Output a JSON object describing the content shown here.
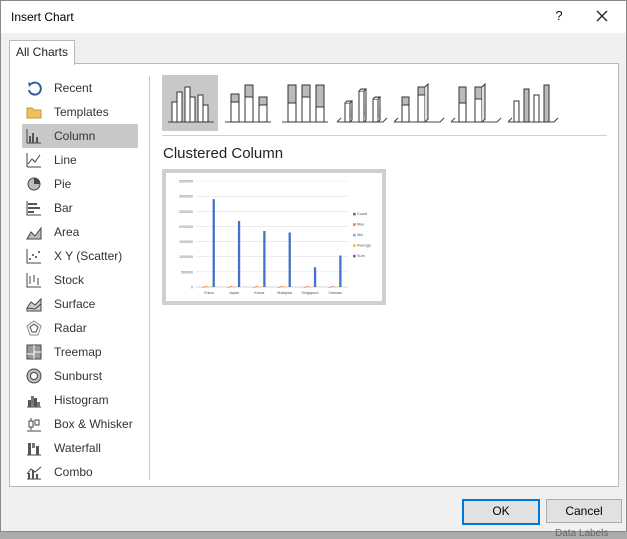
{
  "dialog": {
    "title": "Insert Chart",
    "help": "?"
  },
  "tabs": [
    {
      "label": "All Charts"
    }
  ],
  "sidebar": {
    "items": [
      {
        "label": "Recent",
        "icon": "recent-icon"
      },
      {
        "label": "Templates",
        "icon": "folder-icon"
      },
      {
        "label": "Column",
        "icon": "column-chart-icon",
        "selected": true
      },
      {
        "label": "Line",
        "icon": "line-chart-icon"
      },
      {
        "label": "Pie",
        "icon": "pie-chart-icon"
      },
      {
        "label": "Bar",
        "icon": "bar-chart-icon"
      },
      {
        "label": "Area",
        "icon": "area-chart-icon"
      },
      {
        "label": "X Y (Scatter)",
        "icon": "scatter-chart-icon"
      },
      {
        "label": "Stock",
        "icon": "stock-chart-icon"
      },
      {
        "label": "Surface",
        "icon": "surface-chart-icon"
      },
      {
        "label": "Radar",
        "icon": "radar-chart-icon"
      },
      {
        "label": "Treemap",
        "icon": "treemap-chart-icon"
      },
      {
        "label": "Sunburst",
        "icon": "sunburst-chart-icon"
      },
      {
        "label": "Histogram",
        "icon": "histogram-chart-icon"
      },
      {
        "label": "Box & Whisker",
        "icon": "box-whisker-chart-icon"
      },
      {
        "label": "Waterfall",
        "icon": "waterfall-chart-icon"
      },
      {
        "label": "Combo",
        "icon": "combo-chart-icon"
      }
    ]
  },
  "subtypes": [
    {
      "name": "Clustered Column",
      "selected": true
    },
    {
      "name": "Stacked Column"
    },
    {
      "name": "100% Stacked Column"
    },
    {
      "name": "3-D Clustered Column"
    },
    {
      "name": "3-D Stacked Column"
    },
    {
      "name": "3-D 100% Stacked Column"
    },
    {
      "name": "3-D Column"
    }
  ],
  "selected_subtype_title": "Clustered Column",
  "buttons": {
    "ok": "OK",
    "cancel": "Cancel"
  },
  "underlay_text": "Data Labels",
  "colors": {
    "accent": "#0078d7",
    "selected_bg": "#c8c8c8",
    "count": "#4472c4",
    "max": "#ed7d31",
    "min": "#a5a5a5",
    "average": "#ffc000",
    "sum": "#5b9bd5"
  },
  "chart_data": {
    "type": "bar",
    "categories": [
      "China",
      "Japan",
      "Korea",
      "Malaysia",
      "Singapore",
      "Vietnam"
    ],
    "series": [
      {
        "name": "Count",
        "values": [
          1,
          1,
          1,
          1,
          1,
          1
        ]
      },
      {
        "name": "Max",
        "values": [
          30000,
          30000,
          30000,
          30000,
          30000,
          30000
        ]
      },
      {
        "name": "Min",
        "values": [
          5000,
          5000,
          5000,
          5000,
          5000,
          5000
        ]
      },
      {
        "name": "Average",
        "values": [
          15000,
          15000,
          15000,
          15000,
          15000,
          15000
        ]
      },
      {
        "name": "Sum",
        "values": [
          2900000,
          2180000,
          1850000,
          1800000,
          650000,
          1040000
        ]
      }
    ],
    "yticks": [
      "3500000",
      "3000000",
      "2500000",
      "2000000",
      "1500000",
      "1000000",
      "500000",
      "0"
    ],
    "ylim": [
      0,
      3500000
    ],
    "legend": "right",
    "grid": true
  }
}
